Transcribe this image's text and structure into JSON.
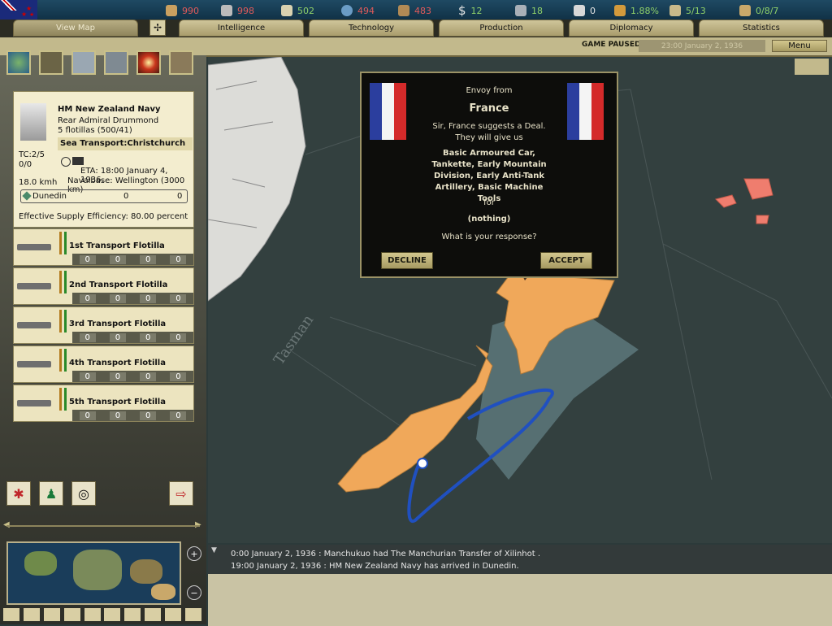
{
  "resources": [
    {
      "icon": "energy-icon",
      "value": "990",
      "color": "#e05a5a"
    },
    {
      "icon": "metal-icon",
      "value": "998",
      "color": "#e05a5a"
    },
    {
      "icon": "rare-materials-icon",
      "value": "502",
      "color": "#8fd06a"
    },
    {
      "icon": "oil-icon",
      "value": "494",
      "color": "#e05a5a"
    },
    {
      "icon": "supplies-icon",
      "value": "483",
      "color": "#e05a5a"
    },
    {
      "icon": "money-icon",
      "value": "12",
      "color": "#8fd06a"
    },
    {
      "icon": "manpower-icon",
      "value": "18",
      "color": "#8fd06a"
    },
    {
      "icon": "diplomacy-icon",
      "value": "0",
      "color": "#e6e6e6"
    },
    {
      "icon": "dissent-icon",
      "value": "1.88%",
      "color": "#8fd06a"
    },
    {
      "icon": "convoy-icon",
      "value": "5/13",
      "color": "#8fd06a"
    },
    {
      "icon": "officer-icon",
      "value": "0/8/7",
      "color": "#8fd06a"
    }
  ],
  "tabs": [
    "View Map",
    "Intelligence",
    "Technology",
    "Production",
    "Diplomacy",
    "Statistics"
  ],
  "status": {
    "paused": "GAME PAUSED",
    "date": "23:00 January 2, 1936",
    "menu": "Menu"
  },
  "unit": {
    "name": "HM New Zealand Navy",
    "commander": "Rear Admiral Drummond",
    "flotillas": "5 flotillas (500/41)",
    "tc": "TC:2/5",
    "tc_sub": "0/0",
    "mission": "Sea Transport:Christchurch",
    "eta": "ETA: 18:00 January 4, 1936.",
    "naval_base": "Navalbase: Wellington (3000 km)",
    "speed": "18.0 kmh",
    "location": "Dunedin",
    "loc_v1": "0",
    "loc_v2": "0",
    "supply": "Effective Supply Efficiency: 80.00 percent"
  },
  "flotillas": [
    {
      "name": "1st Transport Flotilla",
      "stats": [
        "0",
        "0",
        "0",
        "0"
      ]
    },
    {
      "name": "2nd Transport Flotilla",
      "stats": [
        "0",
        "0",
        "0",
        "0"
      ]
    },
    {
      "name": "3rd Transport Flotilla",
      "stats": [
        "0",
        "0",
        "0",
        "0"
      ]
    },
    {
      "name": "4th Transport Flotilla",
      "stats": [
        "0",
        "0",
        "0",
        "0"
      ]
    },
    {
      "name": "5th Transport Flotilla",
      "stats": [
        "0",
        "0",
        "0",
        "0"
      ]
    }
  ],
  "dialog": {
    "envoy_from": "Envoy from",
    "country": "France",
    "line1": "Sir, France suggests a Deal.",
    "line2": "They will give us",
    "offer": "Basic Armoured Car, Tankette, Early Mountain Division, Early Anti-Tank Artillery, Basic Machine Tools",
    "for": "for",
    "request": "(nothing)",
    "question": "What is your response?",
    "decline": "DECLINE",
    "accept": "ACCEPT"
  },
  "log": [
    "0:00 January 2, 1936 : Manchukuo had The Manchurian Transfer of Xilinhot .",
    "19:00 January 2, 1936 : HM New Zealand Navy has arrived in Dunedin."
  ],
  "map_label": "Tasman"
}
